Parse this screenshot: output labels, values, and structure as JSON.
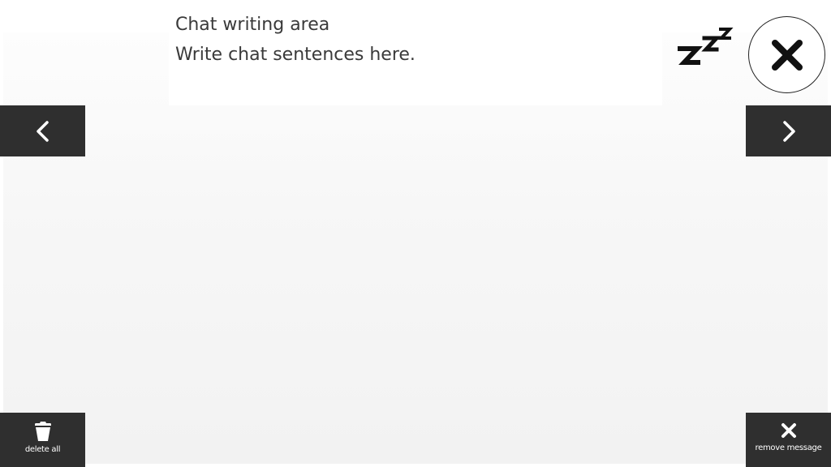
{
  "writing_area": {
    "title": "Chat writing area",
    "placeholder": "Write chat sentences here."
  },
  "nav": {
    "prev_icon": "chevron-left-icon",
    "next_icon": "chevron-right-icon"
  },
  "actions": {
    "delete_all_label": "delete all",
    "delete_all_icon": "trash-icon",
    "remove_message_label": "remove message",
    "remove_message_icon": "x-icon"
  },
  "top_right": {
    "sleep_icon": "zzz-icon",
    "close_icon": "close-icon"
  },
  "colors": {
    "dark_button": "#2f2f2f",
    "text": "#3a3a3a",
    "background": "#f5f5f5"
  }
}
